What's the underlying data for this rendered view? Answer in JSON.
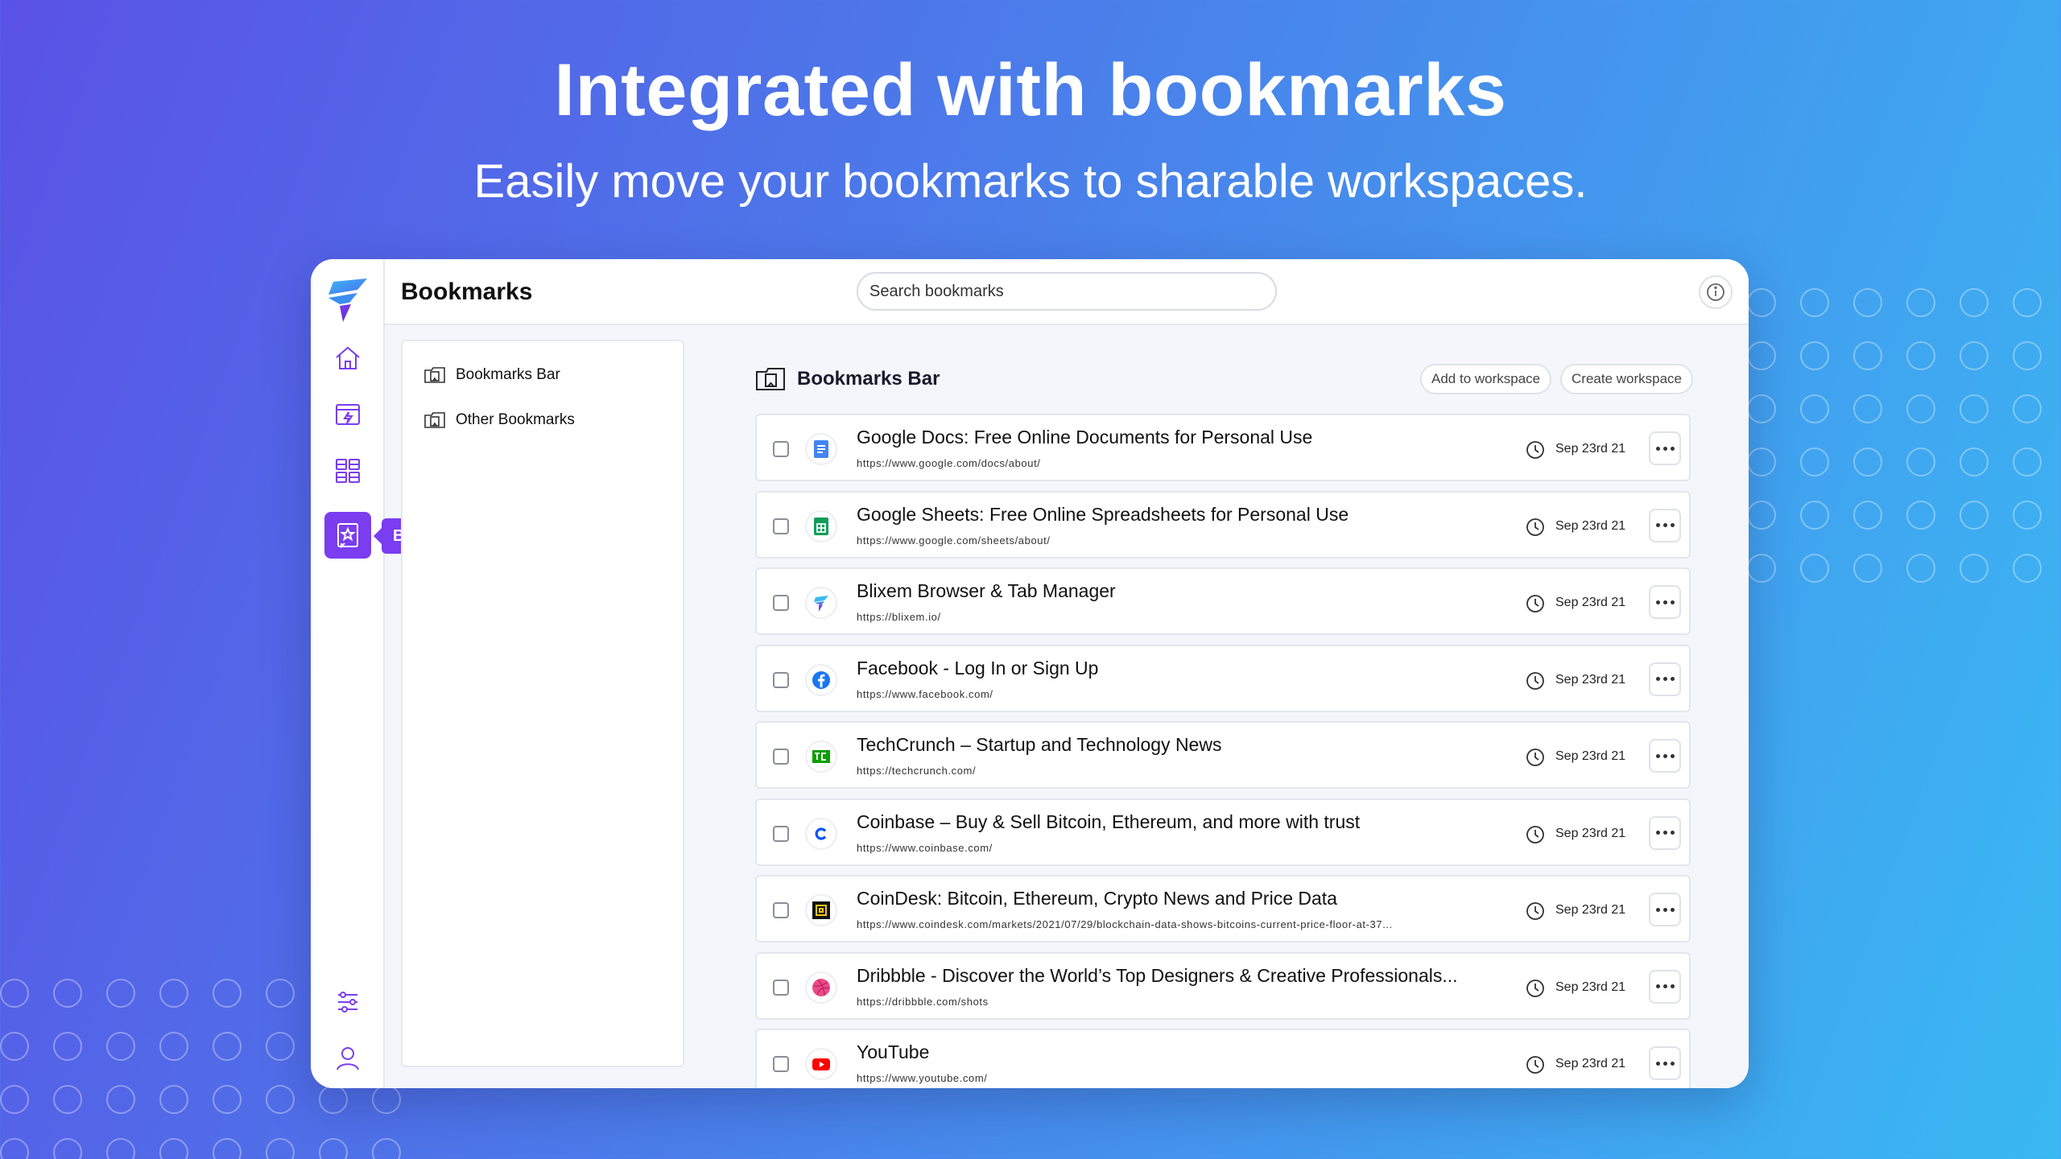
{
  "hero": {
    "title": "Integrated with bookmarks",
    "subtitle": "Easily move your bookmarks to sharable workspaces."
  },
  "colors": {
    "accent": "#7a3df0",
    "background_start": "#5a52e6",
    "background_end": "#3ab9f3"
  },
  "sidebar": {
    "items": [
      {
        "icon": "home-icon"
      },
      {
        "icon": "lightning-tab-icon"
      },
      {
        "icon": "workspaces-grid-icon"
      },
      {
        "icon": "bookmark-star-icon",
        "active": true,
        "tooltip": "Bookmarks"
      }
    ],
    "bottom_items": [
      {
        "icon": "sliders-icon"
      },
      {
        "icon": "user-icon"
      }
    ]
  },
  "header": {
    "title": "Bookmarks",
    "search_placeholder": "Search bookmarks"
  },
  "folders": [
    {
      "label": "Bookmarks Bar"
    },
    {
      "label": "Other Bookmarks"
    }
  ],
  "content": {
    "title": "Bookmarks Bar",
    "add_to_workspace": "Add to workspace",
    "create_workspace": "Create workspace"
  },
  "bookmarks": [
    {
      "title": "Google Docs: Free Online Documents for Personal Use",
      "url": "https://www.google.com/docs/about/",
      "date": "Sep 23rd 21",
      "icon": "google-docs-icon"
    },
    {
      "title": "Google Sheets: Free Online Spreadsheets for Personal Use",
      "url": "https://www.google.com/sheets/about/",
      "date": "Sep 23rd 21",
      "icon": "google-sheets-icon"
    },
    {
      "title": "Blixem Browser & Tab Manager",
      "url": "https://blixem.io/",
      "date": "Sep 23rd 21",
      "icon": "blixem-icon"
    },
    {
      "title": "Facebook - Log In or Sign Up",
      "url": "https://www.facebook.com/",
      "date": "Sep 23rd 21",
      "icon": "facebook-icon"
    },
    {
      "title": "TechCrunch – Startup and Technology News",
      "url": "https://techcrunch.com/",
      "date": "Sep 23rd 21",
      "icon": "techcrunch-icon"
    },
    {
      "title": "Coinbase – Buy & Sell Bitcoin, Ethereum, and more with trust",
      "url": "https://www.coinbase.com/",
      "date": "Sep 23rd 21",
      "icon": "coinbase-icon"
    },
    {
      "title": "CoinDesk: Bitcoin, Ethereum, Crypto News and Price Data",
      "url": "https://www.coindesk.com/markets/2021/07/29/blockchain-data-shows-bitcoins-current-price-floor-at-37...",
      "date": "Sep 23rd 21",
      "icon": "coindesk-icon"
    },
    {
      "title": "Dribbble - Discover the World’s Top Designers & Creative Professionals...",
      "url": "https://dribbble.com/shots",
      "date": "Sep 23rd 21",
      "icon": "dribbble-icon"
    },
    {
      "title": "YouTube",
      "url": "https://www.youtube.com/",
      "date": "Sep 23rd 21",
      "icon": "youtube-icon"
    }
  ]
}
